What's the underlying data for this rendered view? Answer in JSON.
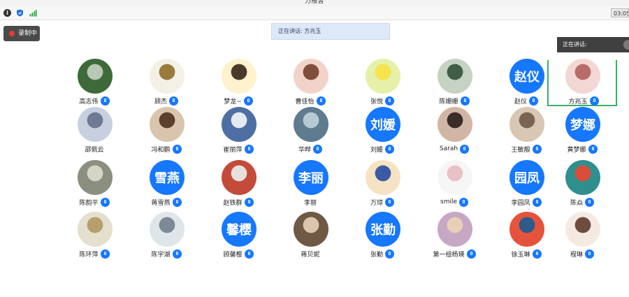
{
  "window": {
    "title": "万般皆"
  },
  "toolbar": {
    "info_icon": "info-icon",
    "shield_icon": "shield-icon",
    "signal_icon": "signal-icon",
    "clock": "03:05"
  },
  "record": {
    "label": "录制中",
    "status_color": "#e83a3a"
  },
  "speaking": {
    "banner": "正在讲话: 方兆玉",
    "panel_label": "正在讲话:"
  },
  "accent": "#1677ff",
  "active_border": "#37b067",
  "participants": [
    [
      {
        "name": "高志伟",
        "avatar": "photo"
      },
      {
        "name": "顾杰",
        "avatar": "photo"
      },
      {
        "name": "梦龙~",
        "avatar": "photo"
      },
      {
        "name": "曹佳怡",
        "avatar": "photo"
      },
      {
        "name": "张悦",
        "avatar": "photo"
      },
      {
        "name": "陈姗姗",
        "avatar": "photo"
      },
      {
        "name": "赵仪",
        "avatar": "text",
        "text": "赵仪"
      },
      {
        "name": "方兆玉",
        "avatar": "photo",
        "active": true
      }
    ],
    [
      {
        "name": "邵佩云",
        "avatar": "photo",
        "muted": true
      },
      {
        "name": "冯和鹏",
        "avatar": "photo"
      },
      {
        "name": "崔丽萍",
        "avatar": "photo"
      },
      {
        "name": "华晔",
        "avatar": "photo"
      },
      {
        "name": "刘媛",
        "avatar": "text",
        "text": "刘媛"
      },
      {
        "name": "Sarah",
        "avatar": "photo"
      },
      {
        "name": "王敏靓",
        "avatar": "photo"
      },
      {
        "name": "黄梦娜",
        "avatar": "text",
        "text": "梦娜"
      }
    ],
    [
      {
        "name": "陈韵平",
        "avatar": "photo"
      },
      {
        "name": "蒋雪燕",
        "avatar": "text",
        "text": "雪燕"
      },
      {
        "name": "赵铁群",
        "avatar": "photo"
      },
      {
        "name": "李丽",
        "avatar": "text",
        "text": "李丽",
        "muted": true
      },
      {
        "name": "万琼",
        "avatar": "photo"
      },
      {
        "name": "smile",
        "avatar": "photo"
      },
      {
        "name": "李园凤",
        "avatar": "text",
        "text": "园凤"
      },
      {
        "name": "陈焱",
        "avatar": "photo"
      }
    ],
    [
      {
        "name": "陈环萍",
        "avatar": "photo"
      },
      {
        "name": "陈宇湖",
        "avatar": "photo"
      },
      {
        "name": "顾馨樱",
        "avatar": "text",
        "text": "馨樱"
      },
      {
        "name": "蒋贝妮",
        "avatar": "photo",
        "muted": true
      },
      {
        "name": "张勤",
        "avatar": "text",
        "text": "张勤"
      },
      {
        "name": "第一组杨瑛",
        "avatar": "photo"
      },
      {
        "name": "徐玉琳",
        "avatar": "photo"
      },
      {
        "name": "程琳",
        "avatar": "photo"
      }
    ]
  ]
}
